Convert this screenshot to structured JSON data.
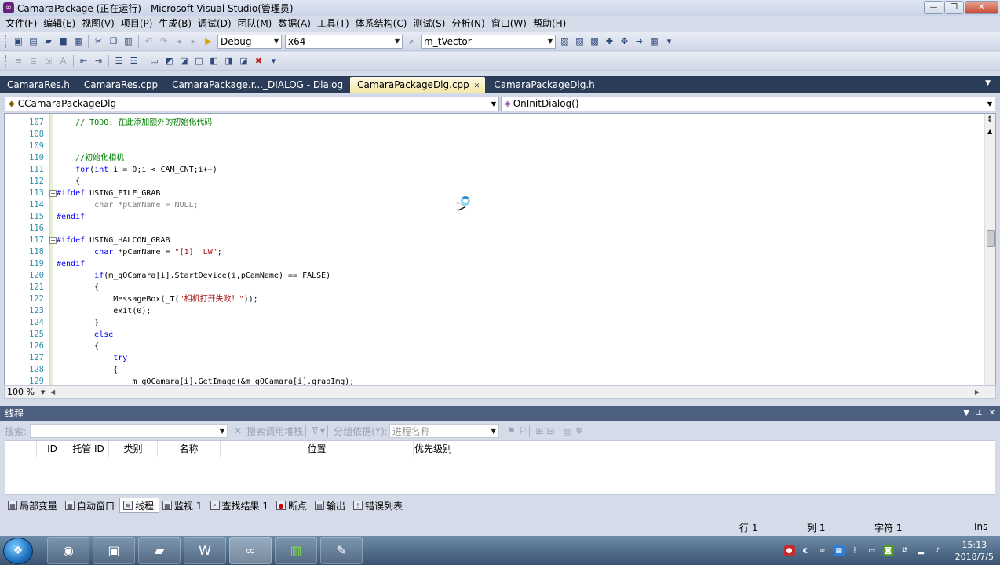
{
  "window": {
    "title": "CamaraPackage (正在运行) - Microsoft Visual Studio(管理员)",
    "minimize": "—",
    "restore": "❐",
    "close": "✕"
  },
  "menu": [
    "文件(F)",
    "编辑(E)",
    "视图(V)",
    "项目(P)",
    "生成(B)",
    "调试(D)",
    "团队(M)",
    "数据(A)",
    "工具(T)",
    "体系结构(C)",
    "测试(S)",
    "分析(N)",
    "窗口(W)",
    "帮助(H)"
  ],
  "toolbar": {
    "config": "Debug",
    "platform": "x64",
    "find": "m_tVector"
  },
  "tabs": [
    {
      "label": "CamaraRes.h",
      "active": false
    },
    {
      "label": "CamaraRes.cpp",
      "active": false
    },
    {
      "label": "CamaraPackage.r..._DIALOG - Dialog",
      "active": false
    },
    {
      "label": "CamaraPackageDlg.cpp",
      "active": true
    },
    {
      "label": "CamaraPackageDlg.h",
      "active": false
    }
  ],
  "nav": {
    "class_combo": "CCamaraPackageDlg",
    "member_combo": "OnInitDialog()"
  },
  "code_lines": [
    {
      "n": "107",
      "html": "    <span class='cm'>// TODO: 在此添加额外的初始化代码</span>"
    },
    {
      "n": "108",
      "html": ""
    },
    {
      "n": "109",
      "html": ""
    },
    {
      "n": "110",
      "html": "    <span class='cm'>//初始化相机</span>"
    },
    {
      "n": "111",
      "html": "    <span class='kw'>for</span>(<span class='kw'>int</span> i = 0;i &lt; CAM_CNT;i++)"
    },
    {
      "n": "112",
      "html": "    {"
    },
    {
      "n": "113",
      "html": "<span class='pp'>#ifdef</span> USING_FILE_GRAB"
    },
    {
      "n": "114",
      "html": "        <span class='gr'>char *pCamName = NULL;</span>"
    },
    {
      "n": "115",
      "html": "<span class='pp'>#endif</span>"
    },
    {
      "n": "116",
      "html": ""
    },
    {
      "n": "117",
      "html": "<span class='pp'>#ifdef</span> USING_HALCON_GRAB"
    },
    {
      "n": "118",
      "html": "        <span class='kw'>char</span> *pCamName = <span class='st'>\"[1]  LW\"</span>;"
    },
    {
      "n": "119",
      "html": "<span class='pp'>#endif</span>"
    },
    {
      "n": "120",
      "html": "        <span class='kw'>if</span>(m_gOCamara[i].StartDevice(i,pCamName) == FALSE)"
    },
    {
      "n": "121",
      "html": "        {"
    },
    {
      "n": "122",
      "html": "            MessageBox(_T(<span class='st'>\"相机打开失败！\"</span>));"
    },
    {
      "n": "123",
      "html": "            exit(0);"
    },
    {
      "n": "124",
      "html": "        }"
    },
    {
      "n": "125",
      "html": "        <span class='kw'>else</span>"
    },
    {
      "n": "126",
      "html": "        {"
    },
    {
      "n": "127",
      "html": "            <span class='kw'>try</span>"
    },
    {
      "n": "128",
      "html": "            {"
    },
    {
      "n": "129",
      "html": "                m_gOCamara[i].GetImage(&amp;m_gOCamara[i].grabImg);"
    }
  ],
  "zoom": "100 %",
  "threads_panel": {
    "title": "线程",
    "search_label": "搜索:",
    "search_callstack": "搜索调用堆栈",
    "group_by_label": "分组依据(Y):",
    "group_by_value": "进程名称",
    "columns": [
      "ID",
      "托管 ID",
      "类别",
      "名称",
      "位置",
      "优先级别"
    ]
  },
  "bottom_tabs": [
    {
      "label": "局部变量",
      "active": false
    },
    {
      "label": "自动窗口",
      "active": false
    },
    {
      "label": "线程",
      "active": true
    },
    {
      "label": "监视 1",
      "active": false
    },
    {
      "label": "查找结果 1",
      "active": false
    },
    {
      "label": "断点",
      "active": false
    },
    {
      "label": "输出",
      "active": false
    },
    {
      "label": "错误列表",
      "active": false
    }
  ],
  "status": {
    "line": "行 1",
    "col": "列 1",
    "char": "字符 1",
    "mode": "Ins"
  },
  "clock": {
    "time": "15:13",
    "date": "2018/7/5"
  },
  "colors": {
    "tabbar": "#2b3c59",
    "active_tab": "#f5e8a8",
    "panel_head": "#4d6082"
  }
}
